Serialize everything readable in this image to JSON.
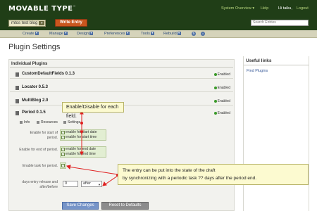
{
  "header": {
    "logo_text": "MOVABLE TYPE",
    "logo_tm": "™",
    "blog_selector": "mtos test blog",
    "write_entry": "Write Entry",
    "system_overview": "System Overview ▾",
    "help": "Help",
    "greeting": "Hi taiku,",
    "logout": "Logout",
    "search_placeholder": "Search Entries"
  },
  "menu": {
    "items": [
      {
        "label": "Create",
        "icon": "dropdown-arrow"
      },
      {
        "label": "Manage",
        "icon": "dropdown-arrow"
      },
      {
        "label": "Design",
        "icon": "dropdown-arrow"
      },
      {
        "label": "Preferences",
        "icon": "dropdown-arrow"
      },
      {
        "label": "Tools",
        "icon": "dropdown-arrow"
      },
      {
        "label": "Rebuild",
        "icon": "dropdown-arrow"
      }
    ],
    "extra_icons": [
      "rebuild-icon",
      "view-site-icon"
    ]
  },
  "page": {
    "title": "Plugin Settings"
  },
  "plugins": {
    "section_title": "Individual Plugins",
    "items": [
      {
        "name": "CustomDefaultFields 0.1.3",
        "status": "Enabled"
      },
      {
        "name": "Locator 0.5.3",
        "status": "Enabled"
      },
      {
        "name": "MultiBlog 2.0",
        "status": "Enabled"
      },
      {
        "name": "Period 0.1.5",
        "status": "Enabled"
      }
    ],
    "tabs": [
      "Info",
      "Resources",
      "Settings"
    ],
    "settings": {
      "start_label": "Enable for start of period.",
      "start_options": [
        "enable for start date",
        "enable for start time"
      ],
      "end_label": "Enable for end of period.",
      "end_options": [
        "enable for end date",
        "enable for end time"
      ],
      "task_label": "Enable task for period.",
      "days_label": "days entry release and after/before",
      "days_value": "0",
      "after_value": "after"
    },
    "save_button": "Save Changes",
    "reset_button": "Reset to Defaults"
  },
  "sidebar": {
    "title": "Useful links",
    "links": [
      "Find Plugins"
    ]
  },
  "callouts": {
    "first": "Enable/Disable for each field.",
    "second_line1": "The entry can be put into the state of the draft",
    "second_line2": "by synchronizing with a periodic task ?? days after the period end."
  },
  "colors": {
    "topbar": "#203e17",
    "write_entry": "#c9561e",
    "menubar": "#d5d3ba",
    "enabled_dot": "#3a9a2a",
    "save_button": "#7694c8",
    "callout_bg": "#fcfad0",
    "annotation": "#e02020"
  }
}
